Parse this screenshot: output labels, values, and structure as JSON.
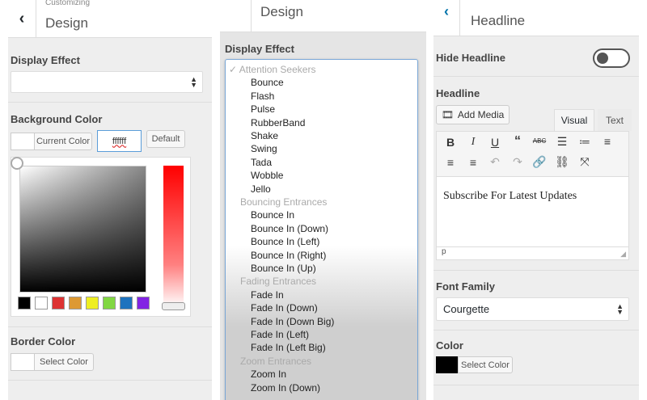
{
  "left_panel": {
    "section_title": "Design",
    "breadcrumb": "Customizing",
    "display_effect_label": "Display Effect",
    "display_effect_value": "",
    "background_color_label": "Background Color",
    "current_color_label": "Current Color",
    "hex_input_value": "ffffff",
    "default_button": "Default",
    "palette": [
      "#000000",
      "#ffffff",
      "#dd3333",
      "#dd9933",
      "#eeee22",
      "#81d742",
      "#1e73be",
      "#8224e3"
    ],
    "border_color_label": "Border Color",
    "select_color_label": "Select Color"
  },
  "middle_panel": {
    "section_title": "Design",
    "display_effect_label": "Display Effect",
    "selected_mark": "✓",
    "groups": [
      {
        "label": "Attention Seekers",
        "options": [
          "Bounce",
          "Flash",
          "Pulse",
          "RubberBand",
          "Shake",
          "Swing",
          "Tada",
          "Wobble",
          "Jello"
        ]
      },
      {
        "label": "Bouncing Entrances",
        "options": [
          "Bounce In",
          "Bounce In (Down)",
          "Bounce In (Left)",
          "Bounce In (Right)",
          "Bounce In (Up)"
        ]
      },
      {
        "label": "Fading Entrances",
        "options": [
          "Fade In",
          "Fade In (Down)",
          "Fade In (Down Big)",
          "Fade In (Left)",
          "Fade In (Left Big)"
        ]
      },
      {
        "label": "Zoom Entrances",
        "options": [
          "Zoom In",
          "Zoom In (Down)"
        ]
      }
    ]
  },
  "right_panel": {
    "section_title": "Headline",
    "hide_headline_label": "Hide Headline",
    "hide_headline_on": false,
    "headline_label": "Headline",
    "add_media_label": "Add Media",
    "tab_visual": "Visual",
    "tab_text": "Text",
    "editor_content": "Subscribe For Latest Updates",
    "editor_path": "p",
    "font_family_label": "Font Family",
    "font_family_value": "Courgette",
    "color_label": "Color",
    "select_color_label": "Select Color",
    "color_value": "#000000",
    "toolbar_icons": [
      "bold-icon",
      "italic-icon",
      "underline-icon",
      "blockquote-icon",
      "strikethrough-icon",
      "bullet-list-icon",
      "numbered-list-icon",
      "align-left-icon",
      "align-center-icon",
      "align-right-icon",
      "undo-icon",
      "redo-icon",
      "link-icon",
      "unlink-icon",
      "fullscreen-icon"
    ]
  }
}
